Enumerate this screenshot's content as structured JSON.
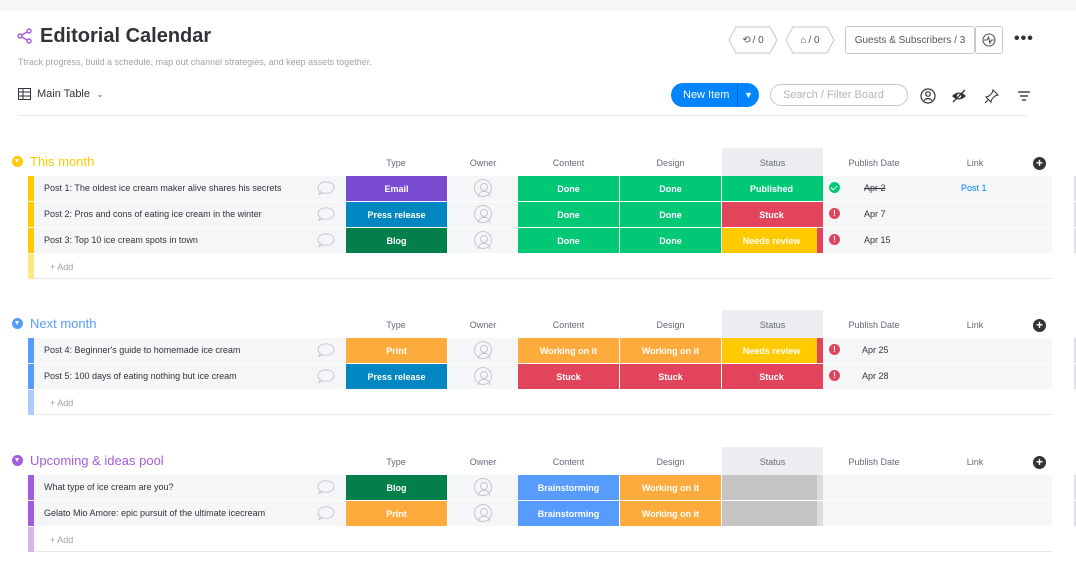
{
  "board": {
    "title": "Editorial Calendar",
    "description": "Ttrack progress, build a schedule, map out channel strategies, and keep assets together."
  },
  "header": {
    "integrations_count": "/ 0",
    "automations_count": "/ 0",
    "guests_label": "Guests & Subscribers / 3",
    "more_label": "•••"
  },
  "toolbar": {
    "view_label": "Main Table",
    "new_item_label": "New Item",
    "search_placeholder": "Search / Filter Board"
  },
  "columns": {
    "type": "Type",
    "owner": "Owner",
    "content": "Content",
    "design": "Design",
    "status": "Status",
    "publish_date": "Publish Date",
    "link": "Link"
  },
  "add_label": "+ Add",
  "colors": {
    "accent": "#0085ff",
    "done": "#00c875",
    "stuck": "#e2445c",
    "working": "#fdab3d",
    "review": "#ffcb00",
    "email": "#784bd1",
    "press": "#0086c0",
    "blog": "#037f4c",
    "brainstorm": "#579bfc",
    "this_month": "#ffcb00",
    "next_month": "#579bfc",
    "upcoming": "#a25ddc"
  },
  "groups": [
    {
      "title": "This month",
      "color": "#ffcb00",
      "rows": [
        {
          "name": "Post 1: The oldest ice cream maker alive shares his secrets",
          "type": "Email",
          "content": "Done",
          "design": "Done",
          "status": "Published",
          "date": "Apr 2",
          "link": "Post 1"
        },
        {
          "name": "Post 2: Pros and cons of eating ice cream in the winter",
          "type": "Press release",
          "content": "Done",
          "design": "Done",
          "status": "Stuck",
          "date": "Apr 7",
          "link": ""
        },
        {
          "name": "Post 3: Top 10 ice cream spots in town",
          "type": "Blog",
          "content": "Done",
          "design": "Done",
          "status": "Needs review",
          "date": "Apr 15",
          "link": ""
        }
      ]
    },
    {
      "title": "Next month",
      "color": "#579bfc",
      "rows": [
        {
          "name": "Post 4: Beginner's guide to homemade ice cream",
          "type": "Print",
          "content": "Working on it",
          "design": "Working on it",
          "status": "Needs review",
          "date": "Apr 25",
          "link": ""
        },
        {
          "name": "Post 5: 100 days of eating nothing but ice cream",
          "type": "Press release",
          "content": "Stuck",
          "design": "Stuck",
          "status": "Stuck",
          "date": "Apr 28",
          "link": ""
        }
      ]
    },
    {
      "title": "Upcoming & ideas pool",
      "color": "#a25ddc",
      "rows": [
        {
          "name": "What type of ice cream are you?",
          "type": "Blog",
          "content": "Brainstorming",
          "design": "Working on it",
          "status": "",
          "date": "",
          "link": ""
        },
        {
          "name": "Gelato Mio Amore: epic pursuit of the ultimate icecream",
          "type": "Print",
          "content": "Brainstorming",
          "design": "Working on it",
          "status": "",
          "date": "",
          "link": ""
        }
      ]
    }
  ]
}
